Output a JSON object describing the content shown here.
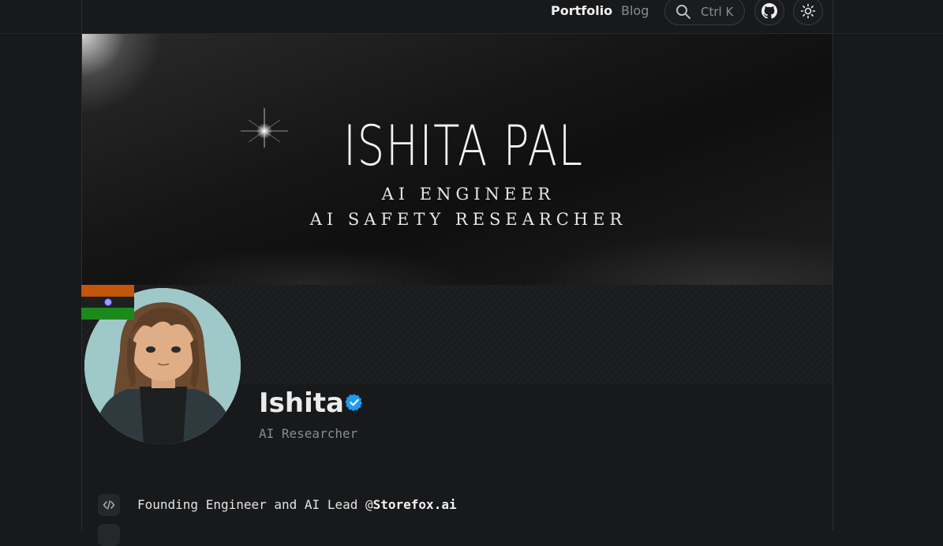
{
  "nav": {
    "links": [
      {
        "label": "Portfolio",
        "active": true
      },
      {
        "label": "Blog",
        "active": false
      }
    ],
    "search": {
      "shortcut": "Ctrl K",
      "icon": "search-icon"
    },
    "github_icon": "github-icon",
    "theme_icon": "sun-icon"
  },
  "banner": {
    "title": "ISHITA PAL",
    "subtitle_1": "AI ENGINEER",
    "subtitle_2": "AI SAFETY RESEARCHER"
  },
  "profile": {
    "name": "Ishita",
    "role": "AI Researcher",
    "verified": true,
    "verified_color": "#1d9bf0",
    "flag": "India"
  },
  "info": {
    "line_1_prefix": "Founding Engineer and AI Lead @",
    "line_1_company": "Storefox.ai",
    "icon": "code-icon"
  },
  "colors": {
    "background": "#18191b",
    "text": "#e8e8e8",
    "muted": "#8a8b8e"
  }
}
